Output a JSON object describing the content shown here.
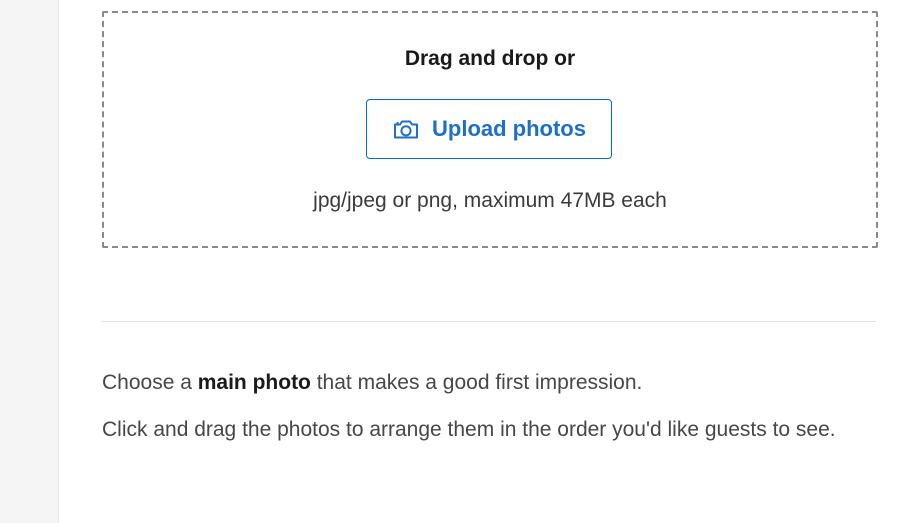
{
  "upload": {
    "heading": "Drag and drop or",
    "button_label": "Upload photos",
    "button_icon": "camera-icon",
    "hint": "jpg/jpeg or png, maximum 47MB each"
  },
  "instructions": {
    "main_prefix": "Choose a ",
    "main_bold": "main photo",
    "main_suffix": " that makes a good first impression.",
    "arrange": "Click and drag the photos to arrange them in the order you'd like guests to see."
  },
  "colors": {
    "accent": "#0071c2",
    "dashed_border": "#8a8a8a",
    "divider": "#e4e4e4"
  }
}
